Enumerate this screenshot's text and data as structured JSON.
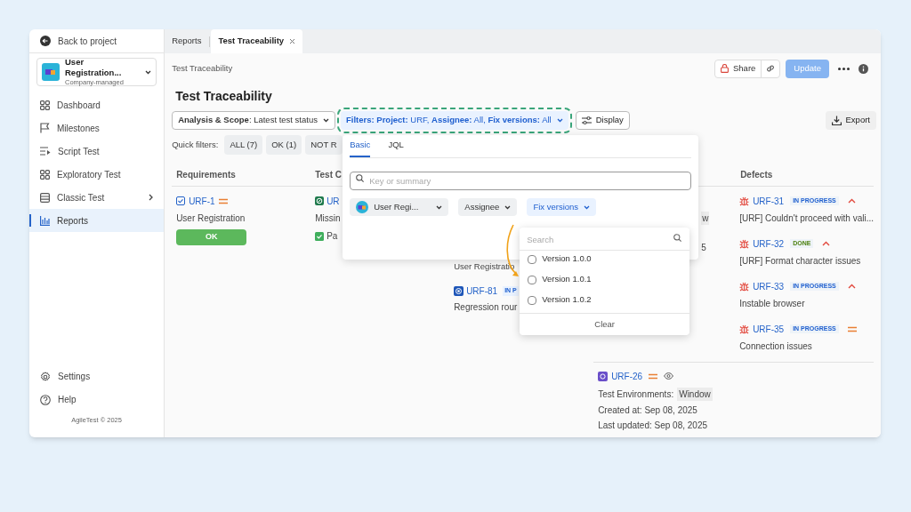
{
  "sidebar": {
    "back_link": "Back to project",
    "project": {
      "name": "User Registration...",
      "type": "Company-managed"
    },
    "nav": [
      {
        "label": "Dashboard",
        "selected": false,
        "expandable": false
      },
      {
        "label": "Milestones",
        "selected": false,
        "expandable": false
      },
      {
        "label": "Script Test",
        "selected": false,
        "expandable": false
      },
      {
        "label": "Exploratory Test",
        "selected": false,
        "expandable": false
      },
      {
        "label": "Classic Test",
        "selected": false,
        "expandable": true
      },
      {
        "label": "Reports",
        "selected": true,
        "expandable": false
      }
    ],
    "footer_nav": [
      {
        "label": "Settings"
      },
      {
        "label": "Help"
      }
    ],
    "copyright": "AgileTest © 2025"
  },
  "tabs": [
    {
      "label": "Reports",
      "selected": false,
      "closable": false
    },
    {
      "label": "Test Traceability",
      "selected": true,
      "closable": true
    }
  ],
  "breadcrumb": "Test Traceability",
  "actions": {
    "share": "Share",
    "update": "Update"
  },
  "title": "Test Traceability",
  "toolbar": {
    "scope": "**Analysis & Scope**: Latest test status",
    "filters": "**Filters: Project:** URF, **Assignee:** All, **Fix versions:** All",
    "filters_highlighted": true,
    "display": "Display",
    "export": "Export"
  },
  "quick_filters": {
    "label": "Quick filters:",
    "items": [
      "ALL (7)",
      "OK (1)",
      "NOT R"
    ]
  },
  "table": {
    "columns": [
      "Requirements",
      "Test C",
      "Defects"
    ],
    "requirements": [
      {
        "key": "URF-1",
        "kind": "medium",
        "summary": "User Registration",
        "status": "OK"
      }
    ],
    "column_2": [
      {
        "key": "UR",
        "summary": "Missin",
        "result": "Pa"
      }
    ],
    "column_3": {
      "text": "User Registratio",
      "items": [
        {
          "key": "URF-81",
          "badge": "IN P",
          "summary": "Regression rour"
        }
      ]
    },
    "column_4": {
      "fragments": [
        "w",
        "5"
      ],
      "item": {
        "key": "URF-26",
        "kind": "medium",
        "environment_label": "Test Environments:",
        "environment": "Window",
        "created": "Created at: Sep 08, 2025",
        "updated": "Last updated: Sep 08, 2025"
      }
    },
    "defects": [
      {
        "key": "URF-31",
        "status": "IN PROGRESS",
        "color": "#1f5fcf",
        "kind": "high",
        "summary": "[URF] Couldn't proceed with vali..."
      },
      {
        "key": "URF-32",
        "status": "DONE",
        "color": "#4b7f0e",
        "kind": "high",
        "summary": "[URF] Format character issues"
      },
      {
        "key": "URF-33",
        "status": "IN PROGRESS",
        "color": "#1f5fcf",
        "kind": "high",
        "summary": "Instable browser"
      },
      {
        "key": "URF-35",
        "status": "IN PROGRESS",
        "color": "#1f5fcf",
        "kind": "medium",
        "summary": "Connection issues"
      }
    ]
  },
  "filter_popup": {
    "tabs": [
      {
        "label": "Basic",
        "selected": true
      },
      {
        "label": "JQL",
        "selected": false
      }
    ],
    "search_placeholder": "Key or summary",
    "selects": [
      {
        "label": "User Regi...",
        "kind": "project",
        "active": false
      },
      {
        "label": "Assignee",
        "kind": "plain",
        "active": false
      },
      {
        "label": "Fix versions",
        "kind": "plain",
        "active": true
      }
    ],
    "version_list": {
      "search_placeholder": "Search",
      "options": [
        {
          "label": "Version 1.0.0",
          "checked": false
        },
        {
          "label": "Version 1.0.1",
          "checked": false
        },
        {
          "label": "Version 1.0.2",
          "checked": false
        }
      ],
      "clear": "Clear"
    }
  }
}
